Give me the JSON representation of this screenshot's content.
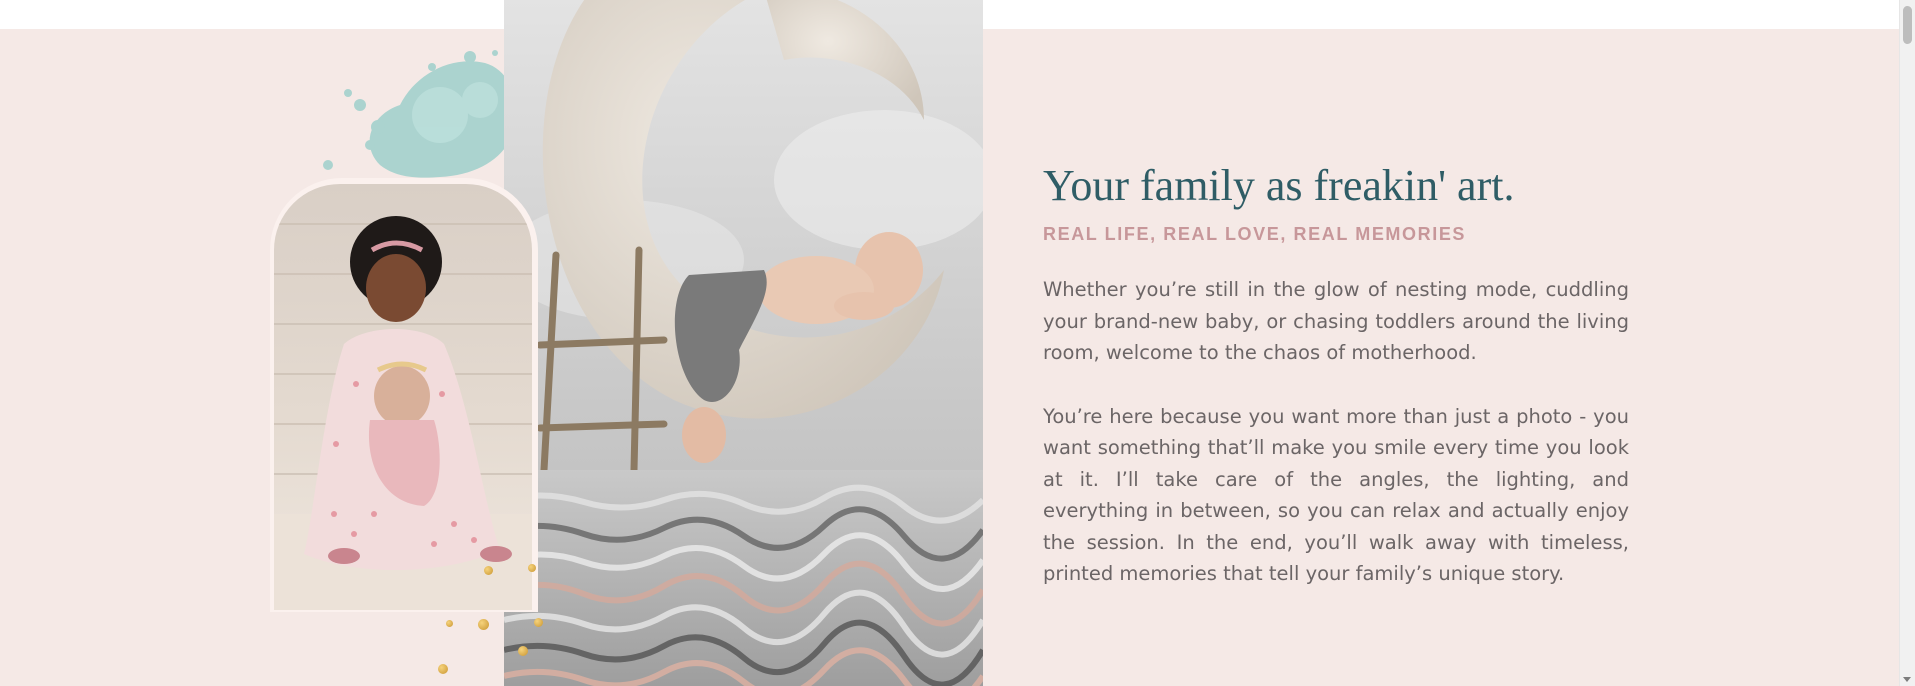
{
  "hero": {
    "headline": "Your family as freakin' art.",
    "subheadline": "REAL LIFE, REAL LOVE, REAL MEMORIES",
    "paragraphs": [
      "Whether you’re still in the glow of nesting mode, cuddling your brand-new baby, or chasing toddlers around the living room, welcome to the chaos of motherhood.",
      "You’re here because you want more than just a photo - you want something that’ll make you smile every time you look at it. I’ll take care of the angles, the lighting, and everything in between, so you can relax and actually enjoy the session. In the end, you’ll walk away with timeless, printed memories that tell your family’s unique story."
    ]
  },
  "images": {
    "left_photo": "sister-holding-newborn-photo",
    "center_photo": "newborn-on-moon-prop-photo",
    "decoration": "watercolor-splash"
  },
  "colors": {
    "band_background": "#f5e9e6",
    "headline": "#2f5d66",
    "subheadline": "#c7979a",
    "body_text": "#6b6566",
    "splash": "#9fd0cb",
    "gold_accent": "#d9a843"
  }
}
